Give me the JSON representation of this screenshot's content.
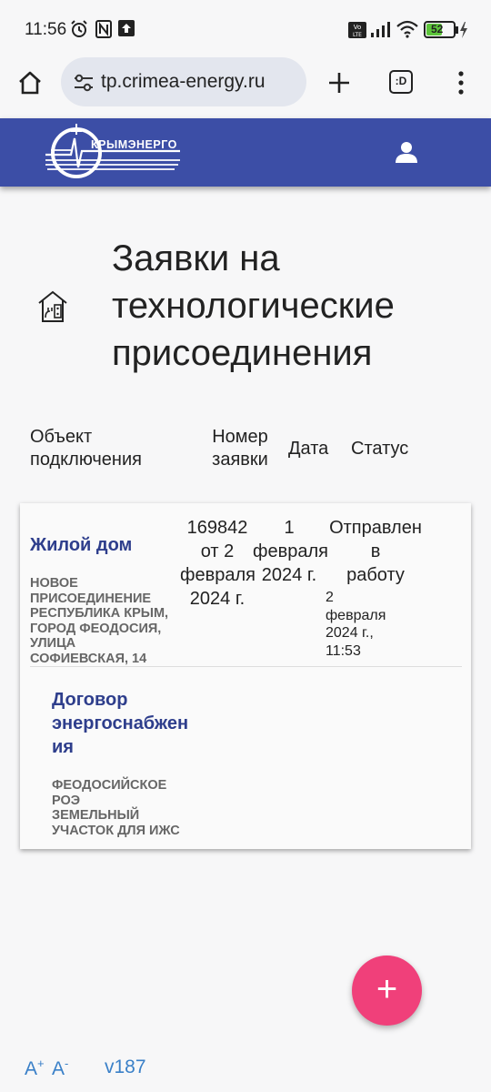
{
  "status_bar": {
    "time": "11:56",
    "battery": "52"
  },
  "browser": {
    "url": "tp.crimea-energy.ru",
    "tabs_label": ":D"
  },
  "header": {
    "logo_text": "КРЫМЭНЕРГО"
  },
  "page": {
    "title_lines": [
      "Заявки на",
      "технологические",
      "присоединения"
    ]
  },
  "table": {
    "headers": {
      "object": [
        "Объект",
        "подключения"
      ],
      "number": [
        "Номер",
        "заявки"
      ],
      "date": "Дата",
      "status": "Статус"
    },
    "row": {
      "object_name": "Жилой дом",
      "object_address": [
        "НОВОЕ",
        "ПРИСОЕДИНЕНИЕ",
        "РЕСПУБЛИКА КРЫМ,",
        "ГОРОД ФЕОДОСИЯ,",
        "УЛИЦА",
        "СОФИЕВСКАЯ, 14"
      ],
      "number": [
        "169842",
        "от 2",
        "февраля",
        "2024 г."
      ],
      "date": [
        "1",
        "февраля",
        "2024 г."
      ],
      "status": [
        "Отправлен",
        "в",
        "работу"
      ],
      "status_time": [
        "2",
        "февраля",
        "2024 г.,",
        "11:53"
      ],
      "contract_name": [
        "Договор",
        "энергоснабжен",
        "ия"
      ],
      "contract_details": [
        "ФЕОДОСИЙСКОЕ",
        "РОЭ",
        "ЗЕМЕЛЬНЫЙ",
        "УЧАСТОК ДЛЯ ИЖС"
      ]
    }
  },
  "fab": {
    "label": "+"
  },
  "footer": {
    "font_increase": "A",
    "font_decrease": "A",
    "plus": "+",
    "minus": "-",
    "version": "v187"
  },
  "colors": {
    "header_bg": "#3c4ea6",
    "fab_bg": "#f0407a",
    "link": "#2e3e8c",
    "footer_link": "#3a80c8"
  }
}
